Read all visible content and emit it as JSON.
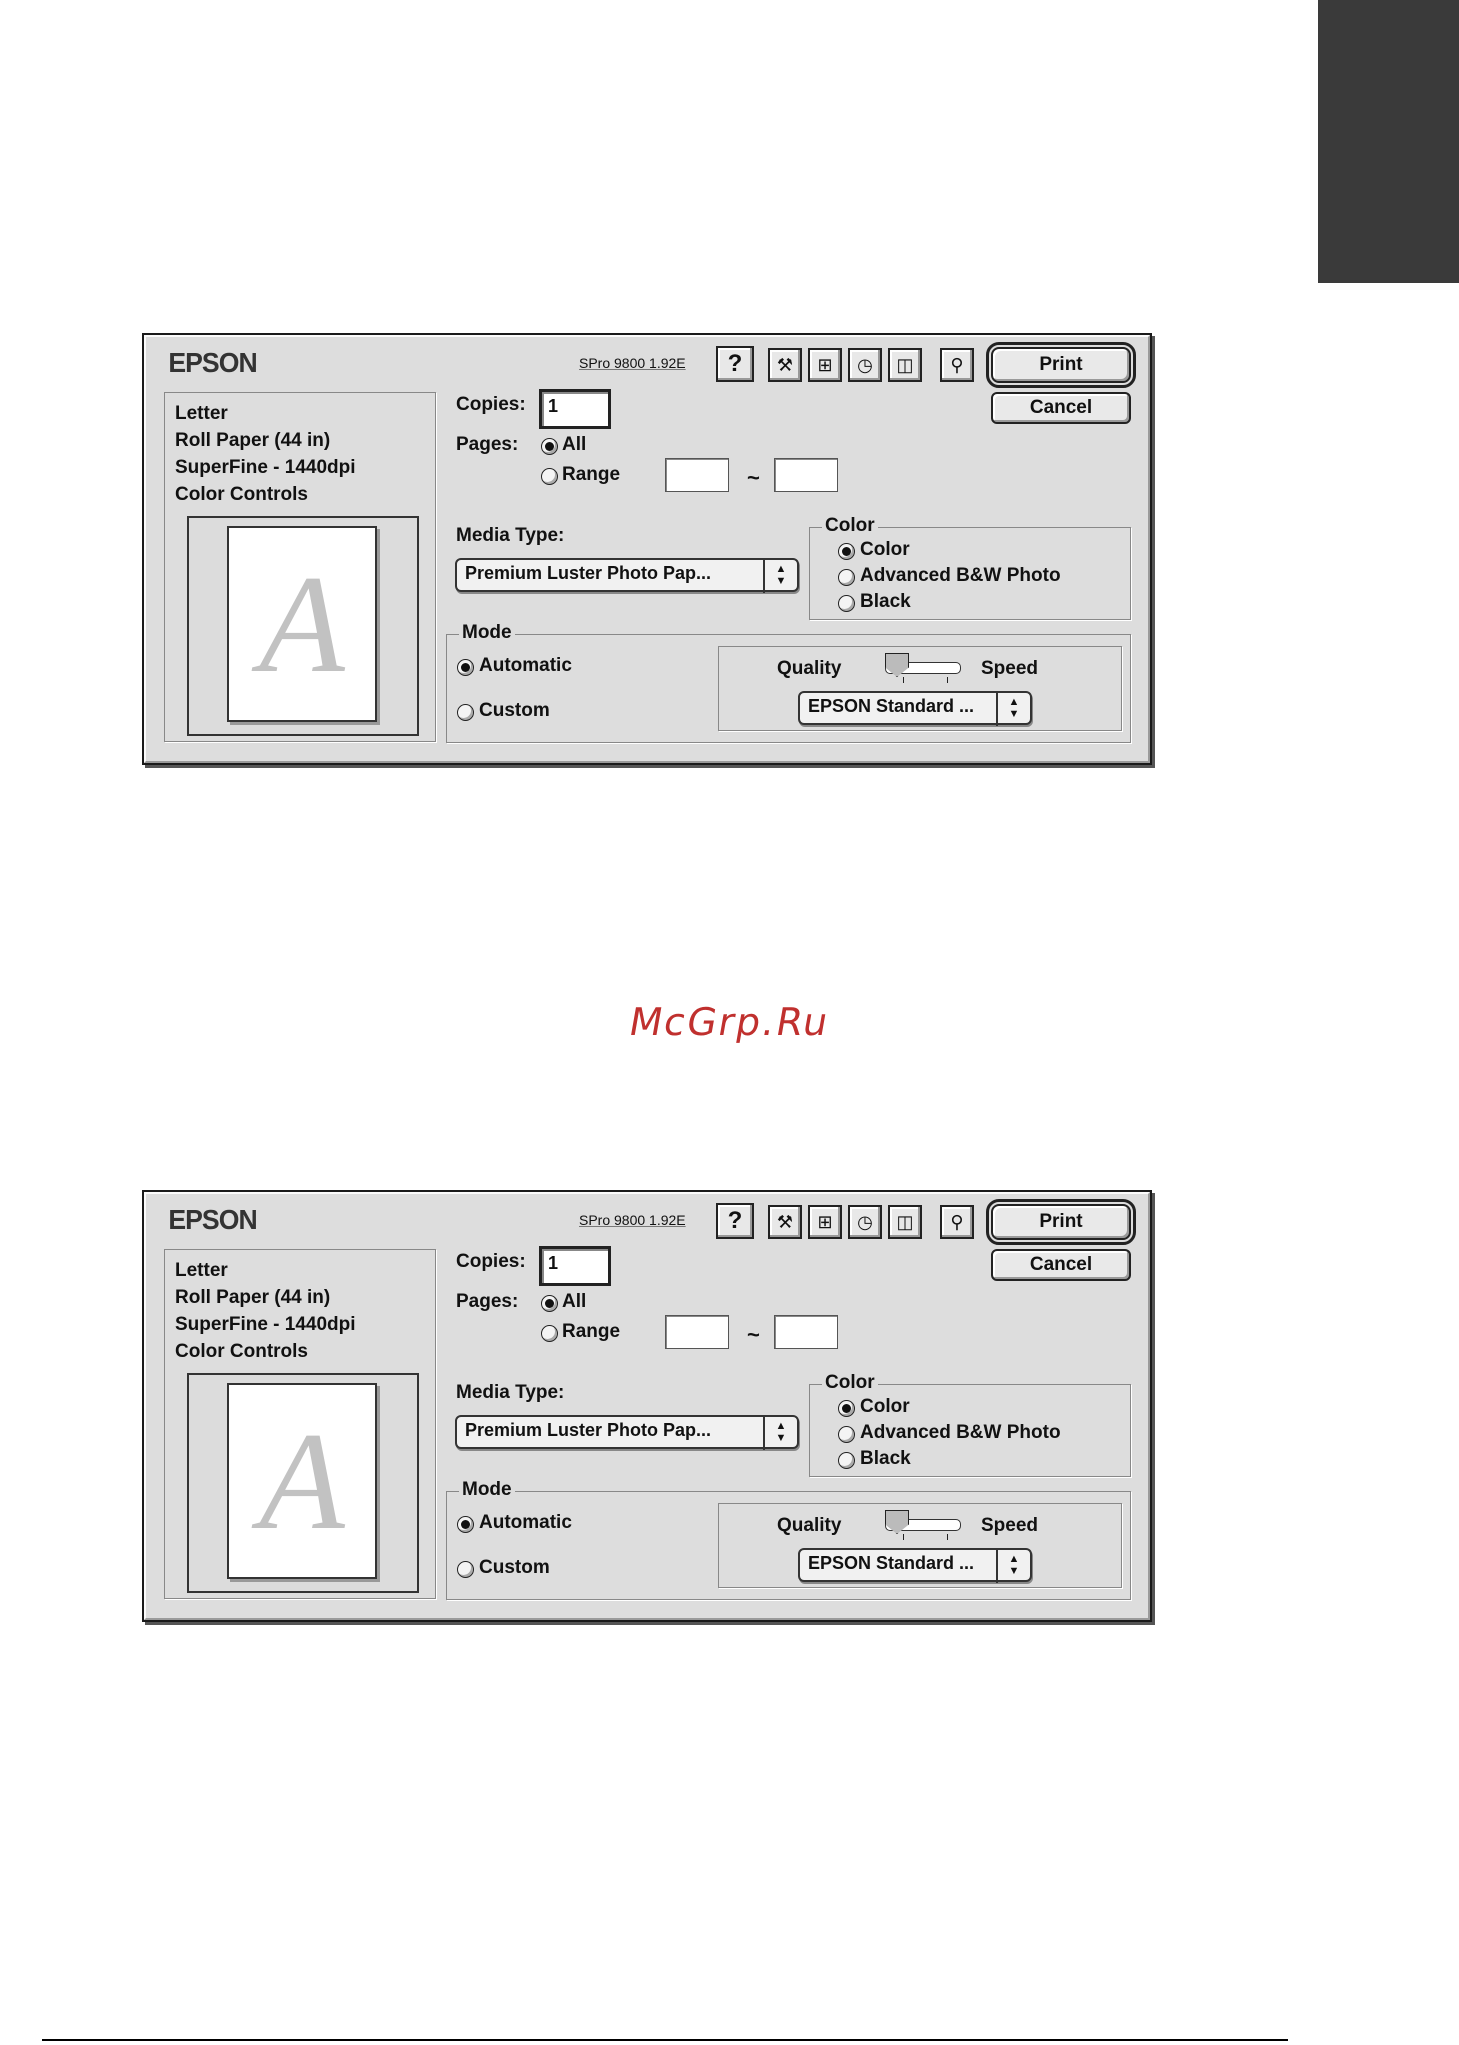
{
  "page": {
    "watermark": "McGrp.Ru"
  },
  "dialogs": [
    {
      "brand": "EPSON",
      "version": "SPro 9800 1.92E",
      "help_label": "?",
      "toolbar_icons": [
        "tools-icon",
        "layout-icon",
        "background-print-icon",
        "ink-levels-icon"
      ],
      "preview_icon": "preview-icon",
      "print_label": "Print",
      "cancel_label": "Cancel",
      "summary": [
        "Letter",
        "Roll Paper (44 in)",
        "SuperFine - 1440dpi",
        "Color Controls"
      ],
      "preview_letter": "A",
      "copies_label": "Copies:",
      "copies_value": "1",
      "pages_label": "Pages:",
      "pages_all": "All",
      "pages_range": "Range",
      "range_sep": "~",
      "media_type_label": "Media Type:",
      "media_type_value": "Premium Luster Photo Pap...",
      "color_group": "Color",
      "color_options": [
        "Color",
        "Advanced B&W Photo",
        "Black"
      ],
      "color_selected": "Color",
      "mode_group": "Mode",
      "mode_options": [
        "Automatic",
        "Custom"
      ],
      "mode_selected": "Automatic",
      "quality_label": "Quality",
      "speed_label": "Speed",
      "quality_speed_level": 0,
      "quality_preset": "EPSON Standard ..."
    },
    {
      "brand": "EPSON",
      "version": "SPro 9800 1.92E",
      "help_label": "?",
      "toolbar_icons": [
        "tools-icon",
        "layout-icon",
        "background-print-icon",
        "ink-levels-icon"
      ],
      "preview_icon": "preview-icon",
      "print_label": "Print",
      "cancel_label": "Cancel",
      "summary": [
        "Letter",
        "Roll Paper (44 in)",
        "SuperFine - 1440dpi",
        "Color Controls"
      ],
      "preview_letter": "A",
      "copies_label": "Copies:",
      "copies_value": "1",
      "pages_label": "Pages:",
      "pages_all": "All",
      "pages_range": "Range",
      "range_sep": "~",
      "media_type_label": "Media Type:",
      "media_type_value": "Premium Luster Photo Pap...",
      "color_group": "Color",
      "color_options": [
        "Color",
        "Advanced B&W Photo",
        "Black"
      ],
      "color_selected": "Color",
      "mode_group": "Mode",
      "mode_options": [
        "Automatic",
        "Custom"
      ],
      "mode_selected": "Automatic",
      "quality_label": "Quality",
      "speed_label": "Speed",
      "quality_speed_level": 0,
      "quality_preset": "EPSON Standard ..."
    }
  ]
}
